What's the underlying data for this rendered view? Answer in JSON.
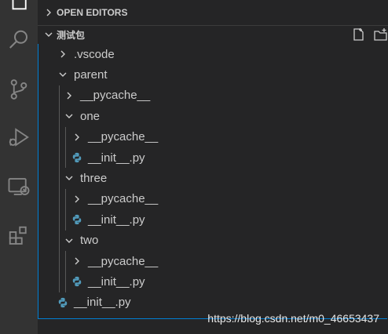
{
  "sidebar": {
    "open_editors": "OPEN EDITORS",
    "folder_name": "测试包"
  },
  "tree": [
    {
      "label": ".vscode",
      "kind": "folder",
      "expanded": false
    },
    {
      "label": "parent",
      "kind": "folder",
      "expanded": true
    },
    {
      "label": "__pycache__",
      "kind": "folder",
      "expanded": false
    },
    {
      "label": "one",
      "kind": "folder",
      "expanded": true
    },
    {
      "label": "__pycache__",
      "kind": "folder",
      "expanded": false
    },
    {
      "label": "__init__.py",
      "kind": "python-file"
    },
    {
      "label": "three",
      "kind": "folder",
      "expanded": true
    },
    {
      "label": "__pycache__",
      "kind": "folder",
      "expanded": false
    },
    {
      "label": "__init__.py",
      "kind": "python-file"
    },
    {
      "label": "two",
      "kind": "folder",
      "expanded": true
    },
    {
      "label": "__pycache__",
      "kind": "folder",
      "expanded": false
    },
    {
      "label": "__init__.py",
      "kind": "python-file"
    },
    {
      "label": "__init__.py",
      "kind": "python-file"
    }
  ],
  "watermark": "https://blog.csdn.net/m0_46653437",
  "colors": {
    "activity_bar": "#333333",
    "sidebar": "#252526",
    "focus_border": "#007fd4",
    "python_blue": "#519aba"
  },
  "icons": {
    "activity": [
      "explorer-icon",
      "search-icon",
      "source-control-icon",
      "run-debug-icon",
      "remote-explorer-icon",
      "extensions-icon"
    ],
    "header_actions": [
      "new-file-icon",
      "new-folder-icon"
    ]
  }
}
